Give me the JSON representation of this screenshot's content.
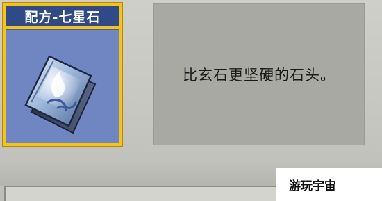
{
  "item": {
    "title": "配方-七星石",
    "icon": "recipe-book-icon",
    "description": "比玄石更坚硬的石头。"
  },
  "watermark": {
    "text": "游玩宇宙"
  },
  "colors": {
    "card_border": "#f4c21c",
    "title_bar": "#2f4a86",
    "art_background": "#6f86c3",
    "panel": "#a9a9a4",
    "background": "#c9c9c4"
  }
}
